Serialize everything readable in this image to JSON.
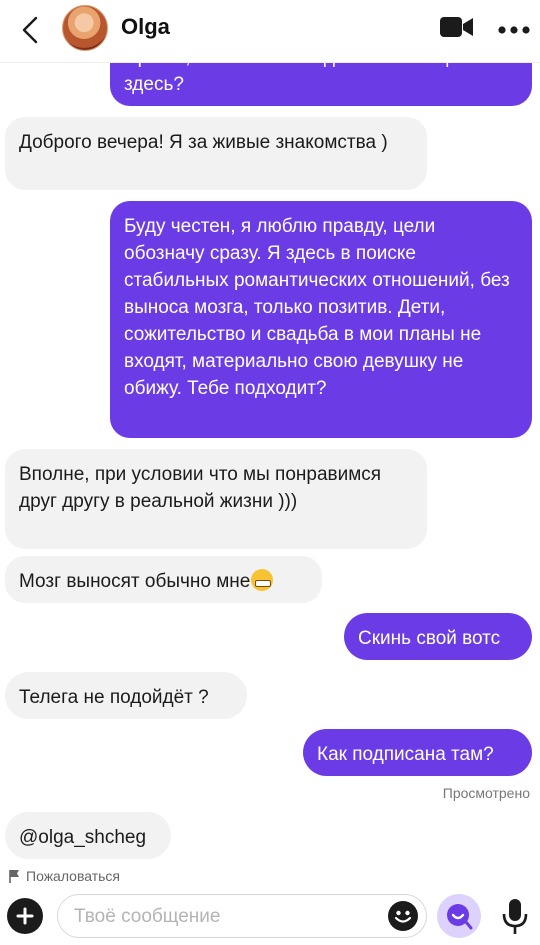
{
  "header": {
    "title": "Olga"
  },
  "messages": [
    {
      "dir": "out",
      "text": "Привет, отлично выглядишь. Какие цели здесь?"
    },
    {
      "dir": "in",
      "text": "Доброго вечера! Я за живые знакомства )"
    },
    {
      "dir": "out",
      "text": "Буду честен, я люблю правду, цели обозначу сразу. Я здесь в поиске стабильных романтических отношений, без выноса мозга, только позитив. Дети, сожительство и свадьба в мои планы не входят, материально свою девушку не обижу. Тебе подходит?"
    },
    {
      "dir": "in",
      "text": "Вполне, при условии что мы понравимся друг другу в реальной жизни )))"
    },
    {
      "dir": "in",
      "text": "Мозг выносят обычно мне"
    },
    {
      "dir": "out",
      "text": "Скинь свой вотс"
    },
    {
      "dir": "in",
      "text": "Телега  не подойдёт ?"
    },
    {
      "dir": "out",
      "text": "Как подписана там?"
    },
    {
      "dir": "in",
      "text": "@olga_shcheg"
    }
  ],
  "status": {
    "seen": "Просмотрено"
  },
  "report": {
    "label": "Пожаловаться"
  },
  "composer": {
    "placeholder": "Твоё сообщение"
  },
  "colors": {
    "outgoing": "#6b3ce6",
    "incoming": "#f2f2f2",
    "ai_button": "#dcd2fb"
  },
  "icons": [
    "back-arrow-icon",
    "video-camera-icon",
    "more-dots-icon",
    "flag-icon",
    "plus-icon",
    "emoji-icon",
    "ai-assistant-icon",
    "microphone-icon",
    "grin-emoji-icon"
  ]
}
